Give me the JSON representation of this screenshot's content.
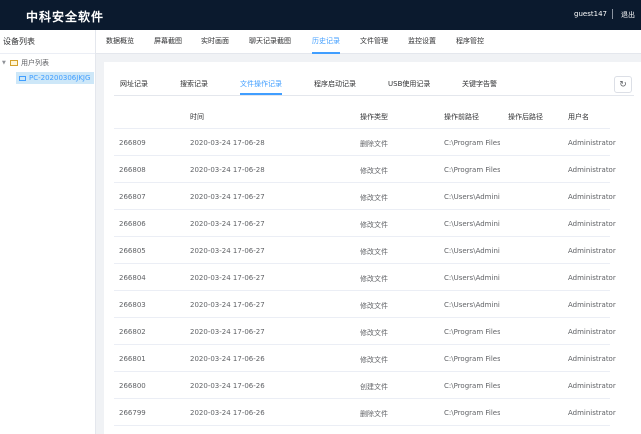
{
  "header": {
    "brand": "中科安全软件",
    "username": "guest147",
    "logout": "退出"
  },
  "sidebar": {
    "title": "设备列表",
    "root_label": "用户列表",
    "device_label": "PC-20200306JKJG"
  },
  "nav": {
    "items": [
      "数据概览",
      "屏幕截图",
      "实时画面",
      "聊天记录截图",
      "历史记录",
      "文件管理",
      "监控设置",
      "程序管控"
    ],
    "active_index": 4
  },
  "subtabs": {
    "items": [
      "网址记录",
      "搜索记录",
      "文件操作记录",
      "程序启动记录",
      "USB使用记录",
      "关键字告警"
    ],
    "active_index": 2
  },
  "table": {
    "columns": [
      "时间",
      "操作类型",
      "操作前路径",
      "操作后路径",
      "用户名"
    ],
    "rows": [
      {
        "id": "266809",
        "time": "2020-03-24 17-06-28",
        "type": "删除文件",
        "before": "C:\\Program Files",
        "after": "",
        "user": "Administrator"
      },
      {
        "id": "266808",
        "time": "2020-03-24 17-06-28",
        "type": "修改文件",
        "before": "C:\\Program Files",
        "after": "",
        "user": "Administrator"
      },
      {
        "id": "266807",
        "time": "2020-03-24 17-06-27",
        "type": "修改文件",
        "before": "C:\\Users\\Adminis",
        "after": "",
        "user": "Administrator"
      },
      {
        "id": "266806",
        "time": "2020-03-24 17-06-27",
        "type": "修改文件",
        "before": "C:\\Users\\Adminis",
        "after": "",
        "user": "Administrator"
      },
      {
        "id": "266805",
        "time": "2020-03-24 17-06-27",
        "type": "修改文件",
        "before": "C:\\Users\\Adminis",
        "after": "",
        "user": "Administrator"
      },
      {
        "id": "266804",
        "time": "2020-03-24 17-06-27",
        "type": "修改文件",
        "before": "C:\\Users\\Adminis",
        "after": "",
        "user": "Administrator"
      },
      {
        "id": "266803",
        "time": "2020-03-24 17-06-27",
        "type": "修改文件",
        "before": "C:\\Users\\Adminis",
        "after": "",
        "user": "Administrator"
      },
      {
        "id": "266802",
        "time": "2020-03-24 17-06-27",
        "type": "修改文件",
        "before": "C:\\Program Files",
        "after": "",
        "user": "Administrator"
      },
      {
        "id": "266801",
        "time": "2020-03-24 17-06-26",
        "type": "修改文件",
        "before": "C:\\Program Files",
        "after": "",
        "user": "Administrator"
      },
      {
        "id": "266800",
        "time": "2020-03-24 17-06-26",
        "type": "创建文件",
        "before": "C:\\Program Files",
        "after": "",
        "user": "Administrator"
      },
      {
        "id": "266799",
        "time": "2020-03-24 17-06-26",
        "type": "删除文件",
        "before": "C:\\Program Files",
        "after": "",
        "user": "Administrator"
      }
    ]
  },
  "colors": {
    "header_bg": "#0b1a2e",
    "accent": "#409eff",
    "selected_bg": "#cde7f8"
  },
  "icons": {
    "refresh": "refresh-icon",
    "folder": "folder-icon",
    "device": "monitor-icon",
    "expand": "caret-down-icon"
  }
}
